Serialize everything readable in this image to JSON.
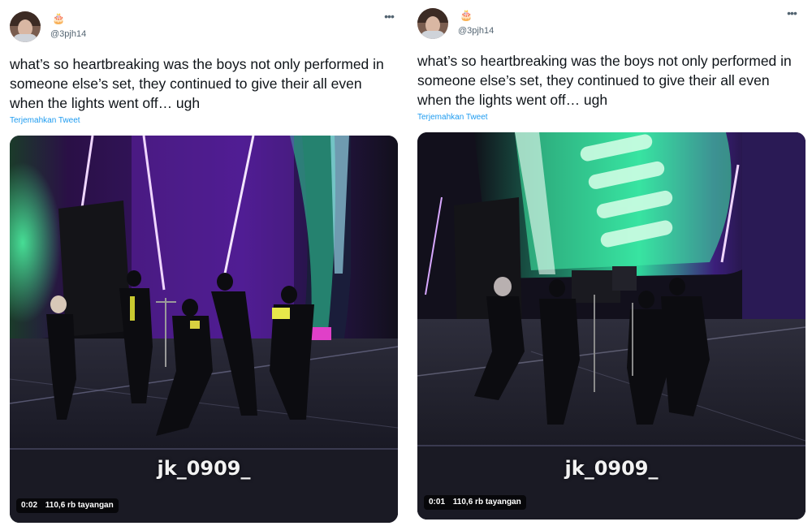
{
  "tweets": [
    {
      "name_emoji": "🎂",
      "handle": "@3pjh14",
      "more_icon": "more-horizontal-icon",
      "text": "what’s so heartbreaking was the boys not only performed in someone else’s set, they continued to give their all even when the lights went off… ugh",
      "translate_label": "Terjemahkan Tweet",
      "media": {
        "watermark": "jk_0909_",
        "timestamp": "0:02",
        "views": "110,6 rb tayangan"
      }
    },
    {
      "name_emoji": "🎂",
      "handle": "@3pjh14",
      "more_icon": "more-horizontal-icon",
      "text": "what’s so heartbreaking was the boys not only performed in someone else’s set, they continued to give their all even when the lights went off… ugh",
      "translate_label": "Terjemahkan Tweet",
      "media": {
        "watermark": "jk_0909_",
        "timestamp": "0:01",
        "views": "110,6 rb tayangan"
      }
    }
  ],
  "colors": {
    "link": "#1d9bf0",
    "secondary_text": "#536471",
    "stage_green": "#2fd59a",
    "stage_purple": "#7a2bd8",
    "stage_pink": "#e040c8"
  }
}
